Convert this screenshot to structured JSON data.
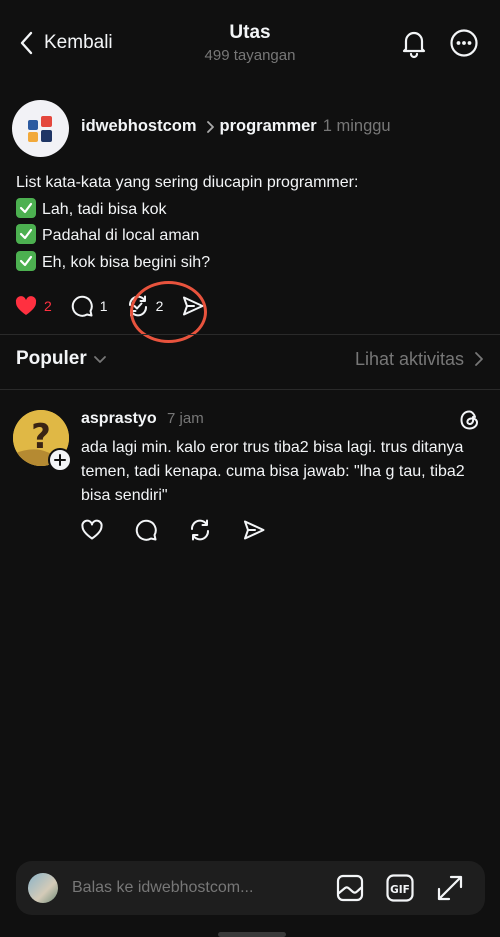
{
  "header": {
    "back_label": "Kembali",
    "title": "Utas",
    "subtitle": "499 tayangan"
  },
  "post": {
    "username": "idwebhostcom",
    "topic": "programmer",
    "time": "1 minggu",
    "text_intro": "List kata-kata yang sering diucapin programmer:",
    "items": [
      "Lah, tadi bisa kok",
      "Padahal di local aman",
      "Eh, kok bisa begini sih?"
    ],
    "likes": "2",
    "comments": "1",
    "reposts": "2",
    "accent_like": "#ff3040",
    "check_color": "#4cb050"
  },
  "sort": {
    "label": "Populer",
    "activity_label": "Lihat aktivitas"
  },
  "reply": {
    "username": "asprastyo",
    "time": "7 jam",
    "text": "ada lagi min. kalo eror trus tiba2 bisa lagi.  trus ditanya temen, tadi kenapa. cuma bisa jawab: \"lha g tau, tiba2 bisa sendiri\""
  },
  "composer": {
    "placeholder": "Balas ke idwebhostcom...",
    "gif_label": "GIF"
  },
  "icons": [
    "chevron-left-icon",
    "bell-icon",
    "more-icon",
    "heart-icon",
    "comment-icon",
    "repost-icon",
    "share-icon",
    "chevron-down-icon",
    "chevron-right-icon",
    "threads-icon",
    "plus-icon",
    "image-icon",
    "gif-icon",
    "expand-icon"
  ]
}
